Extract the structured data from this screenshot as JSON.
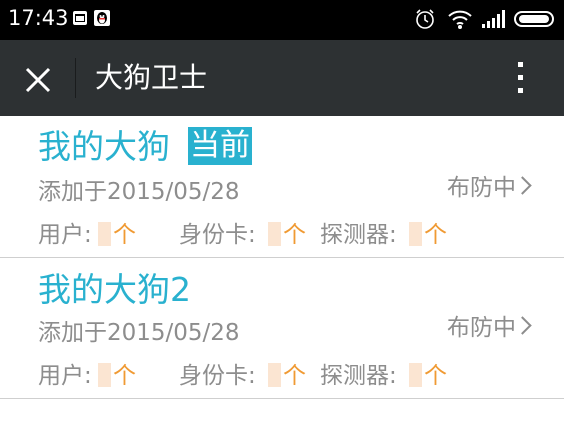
{
  "status_bar": {
    "time": "17:43",
    "left_icons": [
      "gallery-icon",
      "qq-penguin-icon"
    ],
    "right_icons": [
      "alarm-icon",
      "wifi-icon",
      "signal-icon",
      "battery-icon"
    ]
  },
  "title_bar": {
    "title": "大狗卫士",
    "close_icon": "close-icon",
    "more_icon": "more-vert-icon"
  },
  "devices": [
    {
      "name": "我的大狗",
      "badge": "当前",
      "added": "添加于2015/05/28",
      "status": "布防中",
      "counts": [
        {
          "label": "用户:",
          "value": "",
          "unit": "个"
        },
        {
          "label": "身份卡:",
          "value": "",
          "unit": "个"
        },
        {
          "label": "探测器:",
          "value": "",
          "unit": "个"
        }
      ]
    },
    {
      "name": "我的大狗2",
      "badge": "",
      "added": "添加于2015/05/28",
      "status": "布防中",
      "counts": [
        {
          "label": "用户:",
          "value": "",
          "unit": "个"
        },
        {
          "label": "身份卡:",
          "value": "",
          "unit": "个"
        },
        {
          "label": "探测器:",
          "value": "",
          "unit": "个"
        }
      ]
    }
  ],
  "colors": {
    "accent": "#29b1cf",
    "count": "#f09a33",
    "secondary_text": "#8d8d8d",
    "title_bar": "#2d3133"
  }
}
